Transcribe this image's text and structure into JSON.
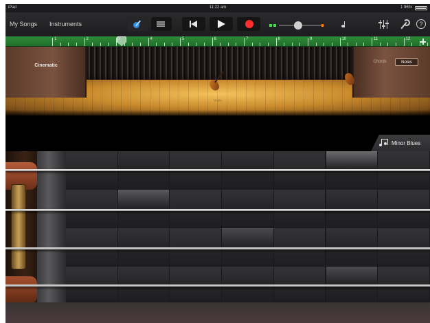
{
  "status_bar": {
    "device": "iPad",
    "time": "11:22 am",
    "battery": "1 96%"
  },
  "toolbar": {
    "my_songs": "My Songs",
    "instruments": "Instruments"
  },
  "ruler": {
    "bars": [
      "1",
      "2",
      "3",
      "4",
      "5",
      "6",
      "7",
      "8",
      "9",
      "10",
      "11",
      "12"
    ]
  },
  "stage": {
    "left_panel_label": "Cinematic",
    "mode_chords": "Chords",
    "mode_notes": "Notes",
    "instrument_name": "Violin"
  },
  "autoplay": {
    "label": "Minor Blues"
  },
  "colors": {
    "accent": "#2f8ee8",
    "record": "#ff2d2d",
    "ruler": "#2f8a3a",
    "meter_green": "#3adf43",
    "meter_orange": "#ff7a00"
  },
  "icons": [
    "guitar-icon",
    "tracks-icon",
    "rewind-icon",
    "play-icon",
    "record-icon",
    "metronome-icon",
    "mixer-icon",
    "wrench-icon",
    "help-icon",
    "add-section-icon",
    "music-note-icon"
  ]
}
